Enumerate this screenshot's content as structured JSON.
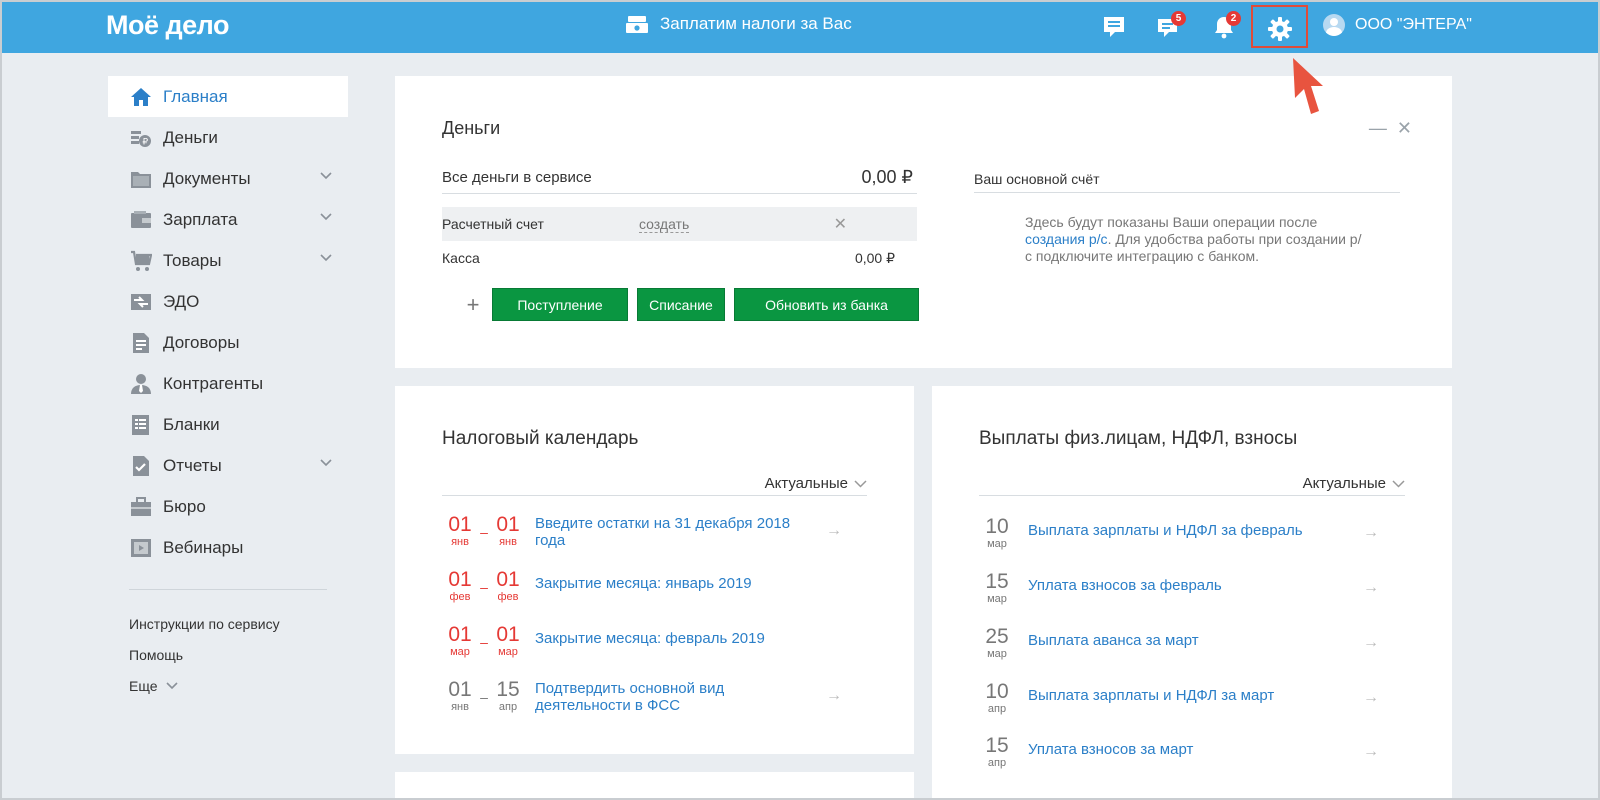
{
  "header": {
    "logo": "Моё дело",
    "promo": "Заплатим налоги за Вас",
    "messages_badge": "5",
    "notifications_badge": "2",
    "user": "ООО \"ЭНТЕРА\"",
    "accent": "#3fa6e0"
  },
  "sidebar": {
    "items": [
      {
        "label": "Главная",
        "icon": "home-icon"
      },
      {
        "label": "Деньги",
        "icon": "money-icon"
      },
      {
        "label": "Документы",
        "icon": "folder-icon"
      },
      {
        "label": "Зарплата",
        "icon": "wallet-icon"
      },
      {
        "label": "Товары",
        "icon": "cart-icon"
      },
      {
        "label": "ЭДО",
        "icon": "edo-icon"
      },
      {
        "label": "Договоры",
        "icon": "contract-icon"
      },
      {
        "label": "Контрагенты",
        "icon": "person-icon"
      },
      {
        "label": "Бланки",
        "icon": "form-icon"
      },
      {
        "label": "Отчеты",
        "icon": "report-icon"
      },
      {
        "label": "Бюро",
        "icon": "briefcase-icon"
      },
      {
        "label": "Вебинары",
        "icon": "video-icon"
      }
    ],
    "links": {
      "instructions": "Инструкции по сервису",
      "help": "Помощь",
      "more": "Еще"
    }
  },
  "money": {
    "title": "Деньги",
    "total_label": "Все деньги в сервисе",
    "total_value": "0,00 ₽",
    "account_label": "Расчетный счет",
    "create_link": "создать",
    "cash_label": "Касса",
    "cash_value": "0,00 ₽",
    "plus": "+",
    "btn_in": "Поступление",
    "btn_out": "Списание",
    "btn_bank": "Обновить из банка",
    "main_account_title": "Ваш основной счёт",
    "main_account_text_1": "Здесь будут показаны Ваши операции после",
    "main_account_link": "создания р/с",
    "main_account_text_2": ". Для удобства работы при создании р/с подключите интеграцию с банком."
  },
  "tax_calendar": {
    "title": "Налоговый календарь",
    "filter": "Актуальные",
    "events": [
      {
        "from_day": "01",
        "from_month": "янв",
        "to_day": "01",
        "to_month": "янв",
        "text": "Введите остатки на 31 декабря 2018 года"
      },
      {
        "from_day": "01",
        "from_month": "фев",
        "to_day": "01",
        "to_month": "фев",
        "text": "Закрытие месяца: январь 2019"
      },
      {
        "from_day": "01",
        "from_month": "мар",
        "to_day": "01",
        "to_month": "мар",
        "text": "Закрытие месяца: февраль 2019"
      },
      {
        "from_day": "01",
        "from_month": "янв",
        "to_day": "15",
        "to_month": "апр",
        "text": "Подтвердить основной вид деятельности в ФСС"
      }
    ]
  },
  "payments": {
    "title": "Выплаты физ.лицам, НДФЛ, взносы",
    "filter": "Актуальные",
    "items": [
      {
        "day": "10",
        "month": "мар",
        "text": "Выплата зарплаты и НДФЛ за февраль"
      },
      {
        "day": "15",
        "month": "мар",
        "text": "Уплата взносов за февраль"
      },
      {
        "day": "25",
        "month": "мар",
        "text": "Выплата аванса за март"
      },
      {
        "day": "10",
        "month": "апр",
        "text": "Выплата зарплаты и НДФЛ за март"
      },
      {
        "day": "15",
        "month": "апр",
        "text": "Уплата взносов за март"
      }
    ]
  }
}
